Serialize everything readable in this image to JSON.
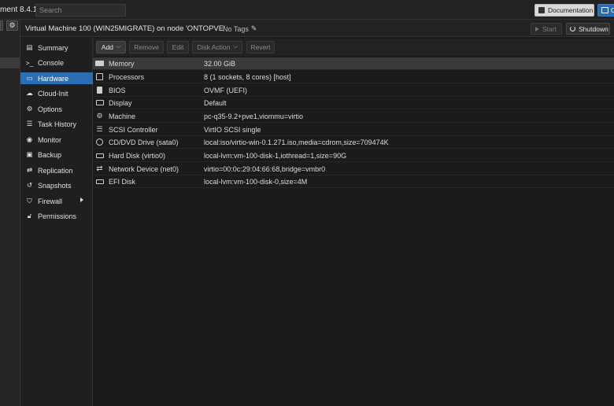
{
  "topbar": {
    "brand": "ment 8.4.1",
    "search_placeholder": "Search",
    "documentation_label": "Documentation",
    "create_label": "C"
  },
  "header": {
    "title": "Virtual Machine 100 (WIN25MIGRATE) on node 'ONTOPVE'",
    "tags_label": "No Tags",
    "start_label": "Start",
    "shutdown_label": "Shutdown"
  },
  "nav": {
    "items": [
      {
        "label": "Summary",
        "icon": "book-icon"
      },
      {
        "label": "Console",
        "icon": "terminal-icon"
      },
      {
        "label": "Hardware",
        "icon": "monitor-icon",
        "selected": true
      },
      {
        "label": "Cloud-Init",
        "icon": "cloud-icon"
      },
      {
        "label": "Options",
        "icon": "gear-icon"
      },
      {
        "label": "Task History",
        "icon": "list-icon"
      },
      {
        "label": "Monitor",
        "icon": "eye-icon"
      },
      {
        "label": "Backup",
        "icon": "floppy-icon"
      },
      {
        "label": "Replication",
        "icon": "retweet-icon"
      },
      {
        "label": "Snapshots",
        "icon": "history-icon"
      },
      {
        "label": "Firewall",
        "icon": "shield-icon",
        "has_submenu": true
      },
      {
        "label": "Permissions",
        "icon": "unlock-icon"
      }
    ]
  },
  "toolbar": {
    "add_label": "Add",
    "remove_label": "Remove",
    "edit_label": "Edit",
    "disk_action_label": "Disk Action",
    "revert_label": "Revert"
  },
  "hardware": {
    "rows": [
      {
        "name": "Memory",
        "value": "32.00 GiB",
        "icon": "memory-icon",
        "selected": true
      },
      {
        "name": "Processors",
        "value": "8 (1 sockets, 8 cores) [host]",
        "icon": "cpu-icon"
      },
      {
        "name": "BIOS",
        "value": "OVMF (UEFI)",
        "icon": "bios-icon"
      },
      {
        "name": "Display",
        "value": "Default",
        "icon": "display-icon"
      },
      {
        "name": "Machine",
        "value": "pc-q35-9.2+pve1,viommu=virtio",
        "icon": "cogs-icon"
      },
      {
        "name": "SCSI Controller",
        "value": "VirtIO SCSI single",
        "icon": "database-icon"
      },
      {
        "name": "CD/DVD Drive (sata0)",
        "value": "local:iso/virtio-win-0.1.271.iso,media=cdrom,size=709474K",
        "icon": "cdrom-icon"
      },
      {
        "name": "Hard Disk (virtio0)",
        "value": "local-lvm:vm-100-disk-1,iothread=1,size=90G",
        "icon": "hdd-icon"
      },
      {
        "name": "Network Device (net0)",
        "value": "virtio=00:0c:29:04:66:68,bridge=vmbr0",
        "icon": "exchange-icon"
      },
      {
        "name": "EFI Disk",
        "value": "local-lvm:vm-100-disk-0,size=4M",
        "icon": "hdd-icon"
      }
    ]
  }
}
